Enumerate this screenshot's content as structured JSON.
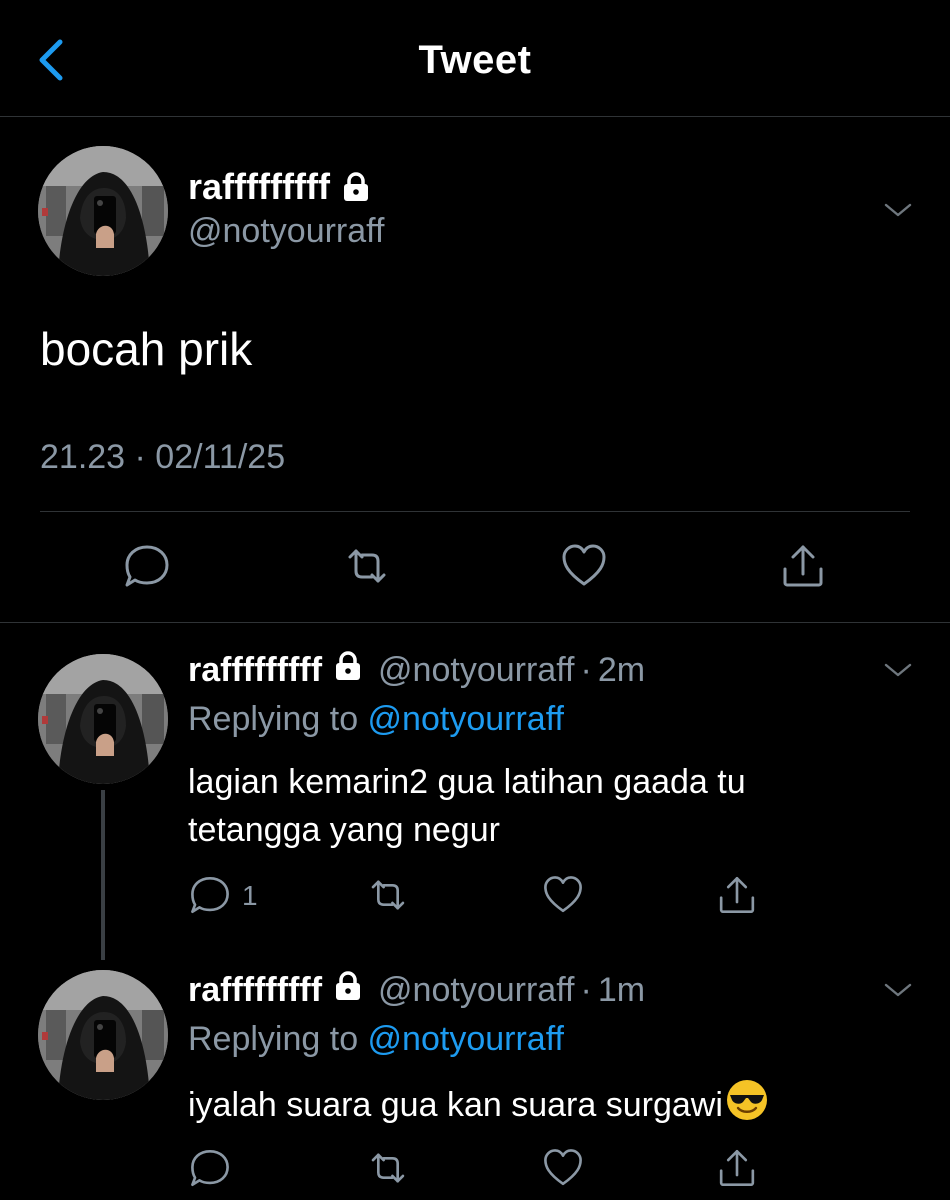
{
  "header": {
    "title": "Tweet"
  },
  "colors": {
    "background": "#000000",
    "muted": "#8b98a5",
    "accent": "#1d9bf0",
    "divider": "#2f3336"
  },
  "main_tweet": {
    "name": "rafffffffff",
    "handle": "@notyourraff",
    "text": "bocah prik",
    "timestamp": "21.23 · 02/11/25",
    "icons": [
      "lock-icon",
      "chevron-down-icon",
      "reply-icon",
      "retweet-icon",
      "like-icon",
      "share-icon"
    ]
  },
  "replies": [
    {
      "name": "rafffffffff",
      "handle": "@notyourraff",
      "separator": "·",
      "time": "2m",
      "replying_prefix": "Replying to ",
      "replying_to": "@notyourraff",
      "text_line1": "lagian kemarin2 gua latihan gaada tu",
      "text_line2": "tetangga yang negur",
      "reply_count": "1"
    },
    {
      "name": "rafffffffff",
      "handle": "@notyourraff",
      "separator": "·",
      "time": "1m",
      "replying_prefix": "Replying to ",
      "replying_to": "@notyourraff",
      "text_line1": "iyalah suara gua kan suara surgawi",
      "emoji": "smiling-face-with-sunglasses"
    }
  ]
}
